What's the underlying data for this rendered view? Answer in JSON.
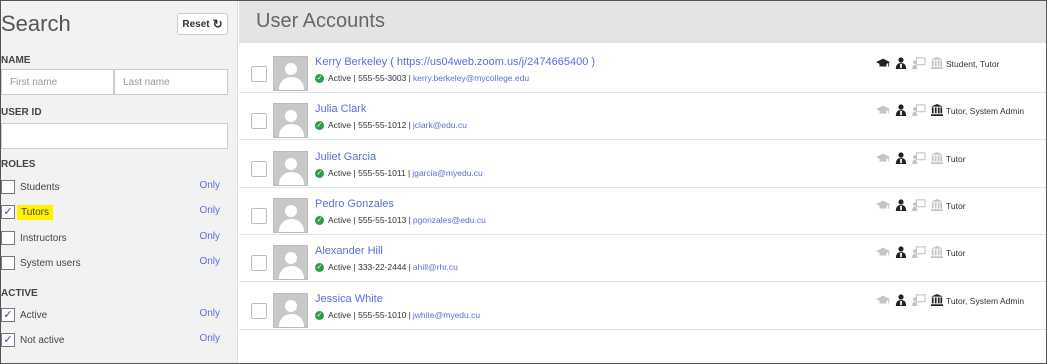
{
  "sidebar": {
    "title": "Search",
    "reset_label": "Reset",
    "name_section": "NAME",
    "first_name_placeholder": "First name",
    "last_name_placeholder": "Last name",
    "user_id_section": "USER ID",
    "user_id_value": "",
    "roles_section": "ROLES",
    "roles": [
      {
        "label": "Students",
        "checked": false,
        "only": "Only"
      },
      {
        "label": "Tutors",
        "checked": true,
        "only": "Only"
      },
      {
        "label": "Instructors",
        "checked": false,
        "only": "Only"
      },
      {
        "label": "System users",
        "checked": false,
        "only": "Only"
      }
    ],
    "active_section": "ACTIVE",
    "active": [
      {
        "label": "Active",
        "checked": true,
        "only": "Only"
      },
      {
        "label": "Not active",
        "checked": true,
        "only": "Only"
      }
    ]
  },
  "main": {
    "title": "User Accounts",
    "users": [
      {
        "name": "Kerry Berkeley ( https://us04web.zoom.us/j/2474665400 )",
        "status": "Active",
        "phone": "555-55-3003",
        "email": "kerry.berkeley@mycollege.edu",
        "roles": "Student, Tutor",
        "icons": [
          "student-icon-on",
          "tutor-icon-on",
          "instructor-icon-off",
          "admin-icon-off"
        ]
      },
      {
        "name": "Julia Clark",
        "status": "Active",
        "phone": "555-55-1012",
        "email": "jclark@edu.cu",
        "roles": "Tutor, System Admin",
        "icons": [
          "student-icon-off",
          "tutor-icon-on",
          "instructor-icon-off",
          "admin-icon-on"
        ]
      },
      {
        "name": "Juliet Garcia",
        "status": "Active",
        "phone": "555-55-1011",
        "email": "jgarcia@myedu.cu",
        "roles": "Tutor",
        "icons": [
          "student-icon-off",
          "tutor-icon-on",
          "instructor-icon-off",
          "admin-icon-off"
        ]
      },
      {
        "name": "Pedro Gonzales",
        "status": "Active",
        "phone": "555-55-1013",
        "email": "pgonzales@edu.cu",
        "roles": "Tutor",
        "icons": [
          "student-icon-off",
          "tutor-icon-on",
          "instructor-icon-off",
          "admin-icon-off"
        ]
      },
      {
        "name": "Alexander Hill",
        "status": "Active",
        "phone": "333-22-2444",
        "email": "ahill@rhr.cu",
        "roles": "Tutor",
        "icons": [
          "student-icon-off",
          "tutor-icon-on",
          "instructor-icon-off",
          "admin-icon-off"
        ]
      },
      {
        "name": "Jessica White",
        "status": "Active",
        "phone": "555-55-1010",
        "email": "jwhite@myedu.cu",
        "roles": "Tutor, System Admin",
        "icons": [
          "student-icon-off",
          "tutor-icon-on",
          "instructor-icon-off",
          "admin-icon-on"
        ]
      }
    ]
  },
  "colors": {
    "link": "#5b6fd6",
    "active_green": "#2e9e4a",
    "highlight": "#fff200",
    "icon_on": "#222222",
    "icon_off": "#c4c4c4"
  }
}
